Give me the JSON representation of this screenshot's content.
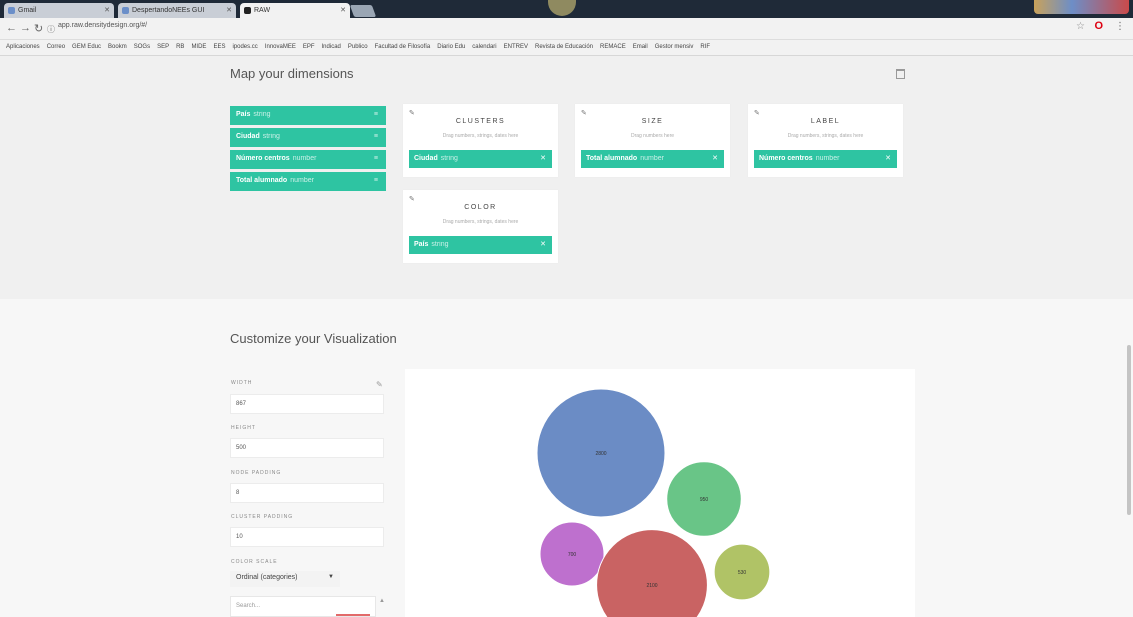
{
  "browser": {
    "tabs": [
      {
        "label": "Gmail",
        "active": false
      },
      {
        "label": "DespertandoNEEs GUI",
        "active": false
      },
      {
        "label": "RAW",
        "active": true
      }
    ],
    "url": "app.raw.densitydesign.org/#/",
    "bookmarks": [
      "Aplicaciones",
      "Correo",
      "GEM Educ",
      "Bookm",
      "SOGs",
      "SEP",
      "RB",
      "MIDE",
      "EES",
      "ipodes.cc",
      "InnovaMEE",
      "EPF",
      "Indicad",
      "Publico",
      "Facultad de Filosofía",
      "Diario Edu",
      "calendari",
      "ENTREV",
      "Revista de Educación",
      "REMACE",
      "Email",
      "Gestor mensiv",
      "RIF"
    ]
  },
  "map": {
    "title": "Map your dimensions",
    "dimensions": [
      {
        "name": "País",
        "type": "string"
      },
      {
        "name": "Ciudad",
        "type": "string"
      },
      {
        "name": "Número centros",
        "type": "number"
      },
      {
        "name": "Total alumnado",
        "type": "number"
      }
    ],
    "cards": [
      {
        "title": "CLUSTERS",
        "hint": "Drag numbers, strings, dates here",
        "chip_name": "Ciudad",
        "chip_type": "string"
      },
      {
        "title": "SIZE",
        "hint": "Drag numbers here",
        "chip_name": "Total alumnado",
        "chip_type": "number"
      },
      {
        "title": "LABEL",
        "hint": "Drag numbers, strings, dates here",
        "chip_name": "Número centros",
        "chip_type": "number"
      },
      {
        "title": "COLOR",
        "hint": "Drag numbers, strings, dates here",
        "chip_name": "País",
        "chip_type": "string"
      }
    ]
  },
  "customize": {
    "title": "Customize your Visualization",
    "options": [
      {
        "label": "WIDTH",
        "value": "867"
      },
      {
        "label": "HEIGHT",
        "value": "500"
      },
      {
        "label": "NODE PADDING",
        "value": "8"
      },
      {
        "label": "CLUSTER PADDING",
        "value": "10"
      }
    ],
    "color_scale_label": "COLOR SCALE",
    "color_scale_value": "Ordinal (categories)",
    "search_placeholder": "Search..."
  },
  "bubbles": [
    {
      "label": "2800",
      "value": 2800,
      "color": "#5b7fbf"
    },
    {
      "label": "950",
      "value": 950,
      "color": "#59bf7a"
    },
    {
      "label": "700",
      "value": 700,
      "color": "#b760c9"
    },
    {
      "label": "2100",
      "value": 2100,
      "color": "#c35252"
    },
    {
      "label": "530",
      "value": 530,
      "color": "#a7bd55"
    }
  ]
}
